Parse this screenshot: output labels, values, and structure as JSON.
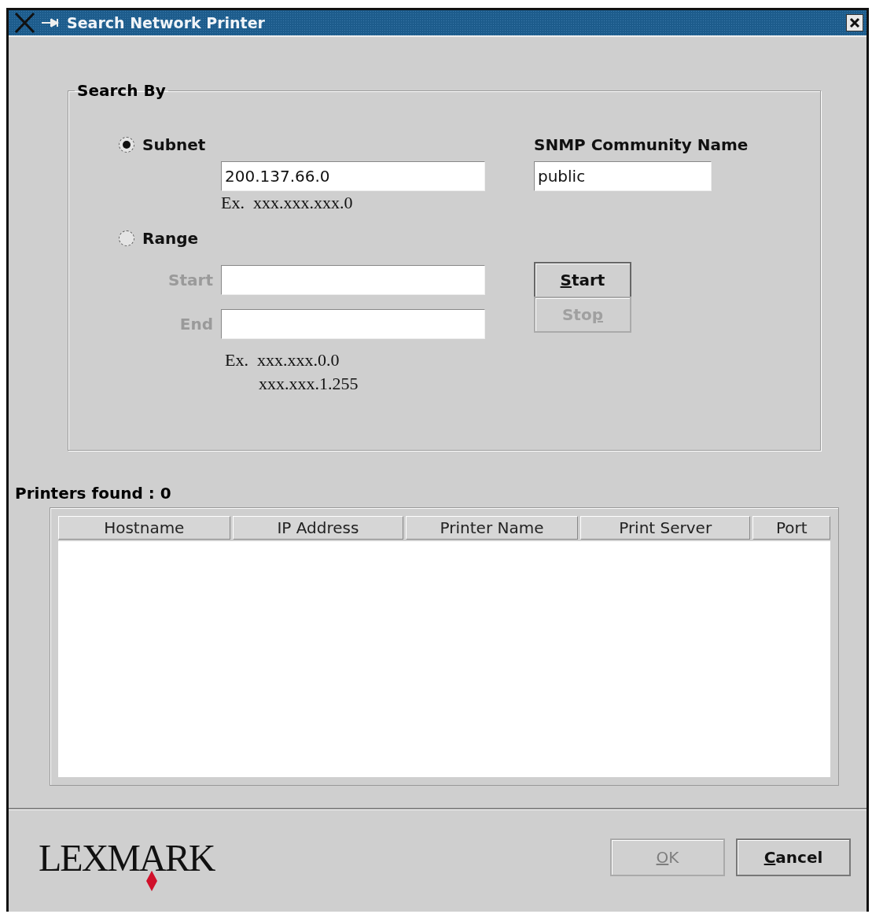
{
  "window": {
    "title": "Search Network Printer"
  },
  "search_by": {
    "legend": "Search By",
    "options": [
      {
        "label": "Subnet",
        "selected": true
      },
      {
        "label": "Range",
        "selected": false
      }
    ],
    "subnet_field": {
      "value": "200.137.66.0"
    },
    "subnet_example": "Ex.  xxx.xxx.xxx.0",
    "range_fields": [
      {
        "label": "Start",
        "disabled": true
      },
      {
        "label": "End",
        "disabled": true
      }
    ],
    "range_example": [
      "Ex.  xxx.xxx.0.0",
      "xxx.xxx.1.255"
    ],
    "snmp": {
      "label": "SNMP Community Name",
      "value": "public"
    },
    "actions": [
      {
        "parts": [
          {
            "text": "S",
            "underlined": true
          },
          {
            "text": "tart",
            "underlined": false
          }
        ],
        "disabled": false
      },
      {
        "parts": [
          {
            "text": "Sto",
            "underlined": false
          },
          {
            "text": "p",
            "underlined": true
          }
        ],
        "disabled": true
      }
    ]
  },
  "results": {
    "label": "Printers found : 0",
    "columns": [
      "Hostname",
      "IP Address",
      "Printer Name",
      "Print Server",
      "Port"
    ]
  },
  "footer": {
    "logo": "LEXMARK",
    "buttons": [
      {
        "parts": [
          {
            "text": "O",
            "underlined": true
          },
          {
            "text": "K",
            "underlined": false
          }
        ],
        "disabled": true
      },
      {
        "parts": [
          {
            "text": "C",
            "underlined": true
          },
          {
            "text": "ancel",
            "underlined": false
          }
        ],
        "disabled": false
      }
    ]
  }
}
